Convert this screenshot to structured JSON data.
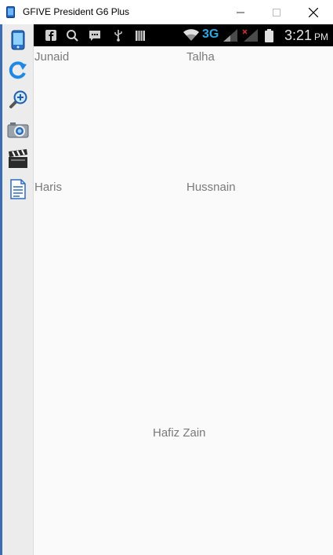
{
  "window": {
    "title": "GFIVE President G6 Plus",
    "minimize_glyph": "—",
    "maximize_glyph": "☐",
    "close_glyph": "✕"
  },
  "toolbar": {
    "tools": [
      {
        "icon": "phone-icon"
      },
      {
        "icon": "rotate-icon"
      },
      {
        "icon": "zoom-icon"
      },
      {
        "icon": "camera-icon"
      },
      {
        "icon": "video-clapper-icon"
      },
      {
        "icon": "document-icon"
      }
    ]
  },
  "statusbar": {
    "network": "3G",
    "time": "3:21",
    "ampm": "PM"
  },
  "names": {
    "junaid": "Junaid",
    "talha": "Talha",
    "haris": "Haris",
    "hussnain": "Hussnain",
    "hafiz_zain": "Hafiz Zain"
  },
  "colors": {
    "accent": "#1e88e5",
    "statusbar": "#000000",
    "text_gray": "#7a7a7a",
    "network_3g": "#2ea7e0"
  }
}
